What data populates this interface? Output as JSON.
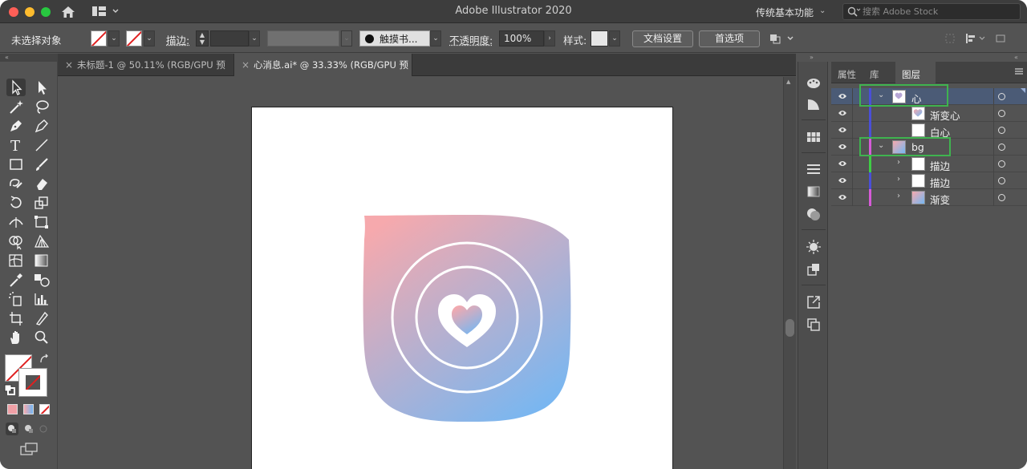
{
  "window": {
    "title": "Adobe Illustrator 2020",
    "workspace": "传统基本功能",
    "search_placeholder": "搜索 Adobe Stock"
  },
  "controlbar": {
    "selection_status": "未选择对象",
    "stroke_label": "描边:",
    "brush_label": "触摸书...",
    "opacity_label": "不透明度:",
    "opacity_value": "100%",
    "style_label": "样式:",
    "doc_setup_button": "文档设置",
    "preferences_button": "首选项"
  },
  "tabs": [
    {
      "label": "未标题-1 @ 50.11% (RGB/GPU 预览)",
      "active": false
    },
    {
      "label": "心消息.ai* @ 33.33% (RGB/GPU 预览)",
      "active": true
    }
  ],
  "layers_panel": {
    "tabs": [
      "属性",
      "库",
      "图层"
    ],
    "active_tab": "图层",
    "rows": [
      {
        "name": "心",
        "level": 0,
        "expanded": true,
        "selected": true,
        "color": "#4a4fd8"
      },
      {
        "name": "渐变心",
        "level": 1,
        "selected": false,
        "color": "#4a4fd8"
      },
      {
        "name": "白心",
        "level": 1,
        "selected": false,
        "color": "#4a4fd8"
      },
      {
        "name": "bg",
        "level": 0,
        "expanded": true,
        "selected": false,
        "color": "#d65bd8"
      },
      {
        "name": "描边",
        "level": 1,
        "expanded": false,
        "selected": false,
        "color": "#3fcc45"
      },
      {
        "name": "描边",
        "level": 1,
        "expanded": false,
        "selected": false,
        "color": "#4a4fd8"
      },
      {
        "name": "渐变",
        "level": 1,
        "expanded": false,
        "selected": false,
        "color": "#d65bd8"
      }
    ]
  },
  "artwork": {
    "gradient_start": "#f6a9ad",
    "gradient_end": "#74b7f3",
    "ring_color": "#ffffff"
  },
  "highlight_color": "#3fb34f"
}
